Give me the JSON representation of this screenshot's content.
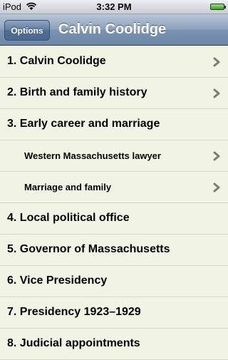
{
  "status": {
    "carrier": "iPod",
    "time": "3:32 PM"
  },
  "navbar": {
    "options_label": "Options",
    "title": "Calvin Coolidge"
  },
  "list": [
    {
      "label": "1. Calvin Coolidge",
      "chevron": true
    },
    {
      "label": "2. Birth and family history",
      "chevron": true
    },
    {
      "label": "3. Early career and marriage",
      "chevron": false
    },
    {
      "label": "Western Massachusetts lawyer",
      "chevron": true
    },
    {
      "label": "Marriage and family",
      "chevron": true
    },
    {
      "label": "4. Local political office",
      "chevron": false
    },
    {
      "label": "5. Governor of Massachusetts",
      "chevron": false
    },
    {
      "label": "6. Vice Presidency",
      "chevron": false
    },
    {
      "label": "7. Presidency 1923–1929",
      "chevron": false
    },
    {
      "label": "8. Judicial appointments",
      "chevron": false
    }
  ]
}
